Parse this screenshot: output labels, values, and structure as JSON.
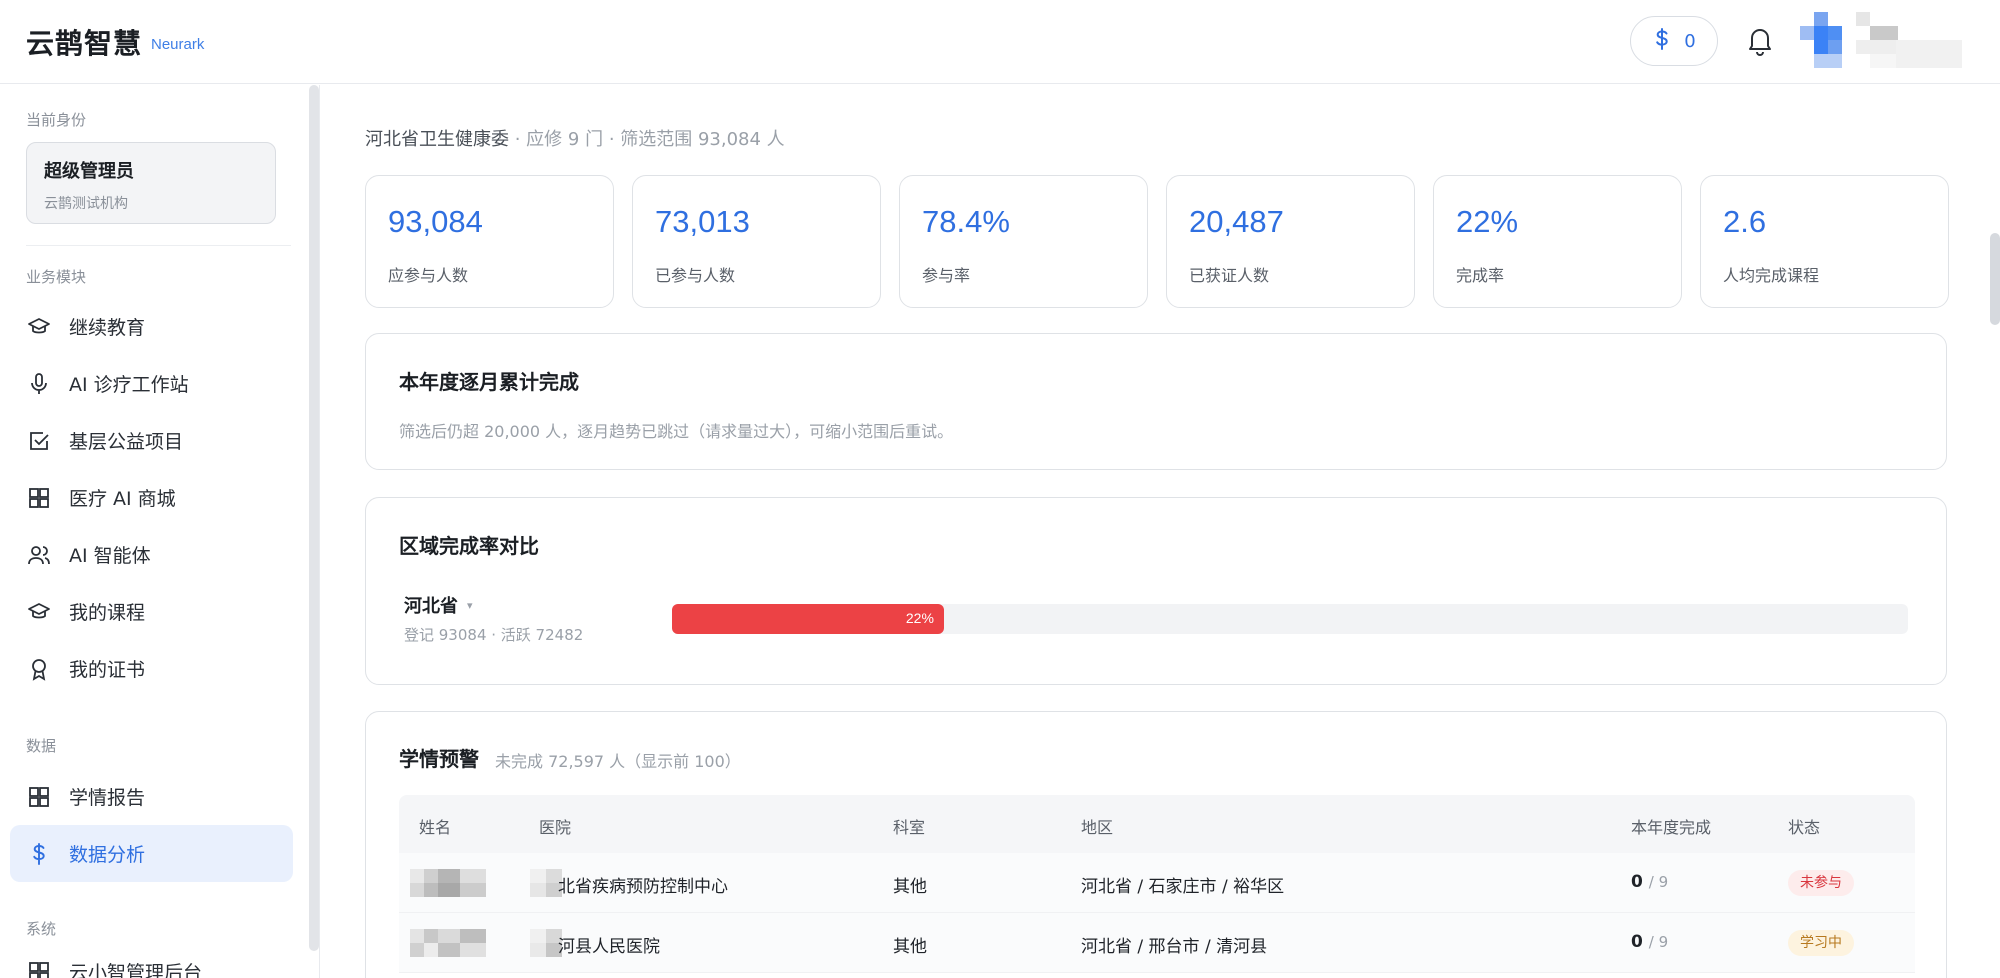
{
  "app": {
    "name_cn": "云鹊智慧",
    "name_en": "Neurark"
  },
  "header": {
    "credits": "0",
    "credit_icon": "dollar-icon",
    "notification_icon": "bell-icon"
  },
  "sidebar": {
    "identity_section_label": "当前身份",
    "identity": {
      "role": "超级管理员",
      "org": "云鹊测试机构"
    },
    "business_section_label": "业务模块",
    "business_items": [
      {
        "label": "继续教育",
        "icon": "graduation-cap-icon"
      },
      {
        "label": "AI 诊疗工作站",
        "icon": "microphone-icon"
      },
      {
        "label": "基层公益项目",
        "icon": "checkbox-icon"
      },
      {
        "label": "医疗 AI 商城",
        "icon": "grid-icon"
      },
      {
        "label": "AI 智能体",
        "icon": "users-icon"
      },
      {
        "label": "我的课程",
        "icon": "graduation-cap-icon"
      },
      {
        "label": "我的证书",
        "icon": "award-icon"
      }
    ],
    "data_section_label": "数据",
    "data_items": [
      {
        "label": "学情报告",
        "icon": "grid-icon"
      },
      {
        "label": "数据分析",
        "icon": "dollar-icon",
        "active": true
      }
    ],
    "system_section_label": "系统",
    "system_items": [
      {
        "label": "云小智管理后台",
        "icon": "grid-icon"
      }
    ]
  },
  "main": {
    "context": {
      "org": "河北省卫生健康委",
      "required": "· 应修 9 门",
      "scope": "· 筛选范围 93,084 人"
    },
    "stats": [
      {
        "value": "93,084",
        "label": "应参与人数"
      },
      {
        "value": "73,013",
        "label": "已参与人数"
      },
      {
        "value": "78.4%",
        "label": "参与率"
      },
      {
        "value": "20,487",
        "label": "已获证人数"
      },
      {
        "value": "22%",
        "label": "完成率"
      },
      {
        "value": "2.6",
        "label": "人均完成课程"
      }
    ],
    "monthly": {
      "title": "本年度逐月累计完成",
      "note": "筛选后仍超 20,000 人，逐月趋势已跳过（请求量过大），可缩小范围后重试。"
    },
    "region": {
      "title": "区域完成率对比",
      "name": "河北省",
      "caret": "▾",
      "sub": "登记 93084 · 活跃 72482",
      "rate_label": "22%",
      "rate": 0.22,
      "bar_color": "#ec4245"
    },
    "warning": {
      "title": "学情预警",
      "subtitle": "未完成 72,597 人（显示前 100）",
      "columns": [
        "姓名",
        "医院",
        "科室",
        "地区",
        "本年度完成",
        "状态"
      ],
      "rows": [
        {
          "hospital": "北省疾病预防控制中心",
          "dept": "其他",
          "region": "河北省 / 石家庄市 / 裕华区",
          "done": "0",
          "total": "/ 9",
          "status": "未参与",
          "status_type": "red"
        },
        {
          "hospital": "河县人民医院",
          "dept": "其他",
          "region": "河北省 / 邢台市 / 清河县",
          "done": "0",
          "total": "/ 9",
          "status": "学习中",
          "status_type": "amber"
        }
      ]
    }
  }
}
